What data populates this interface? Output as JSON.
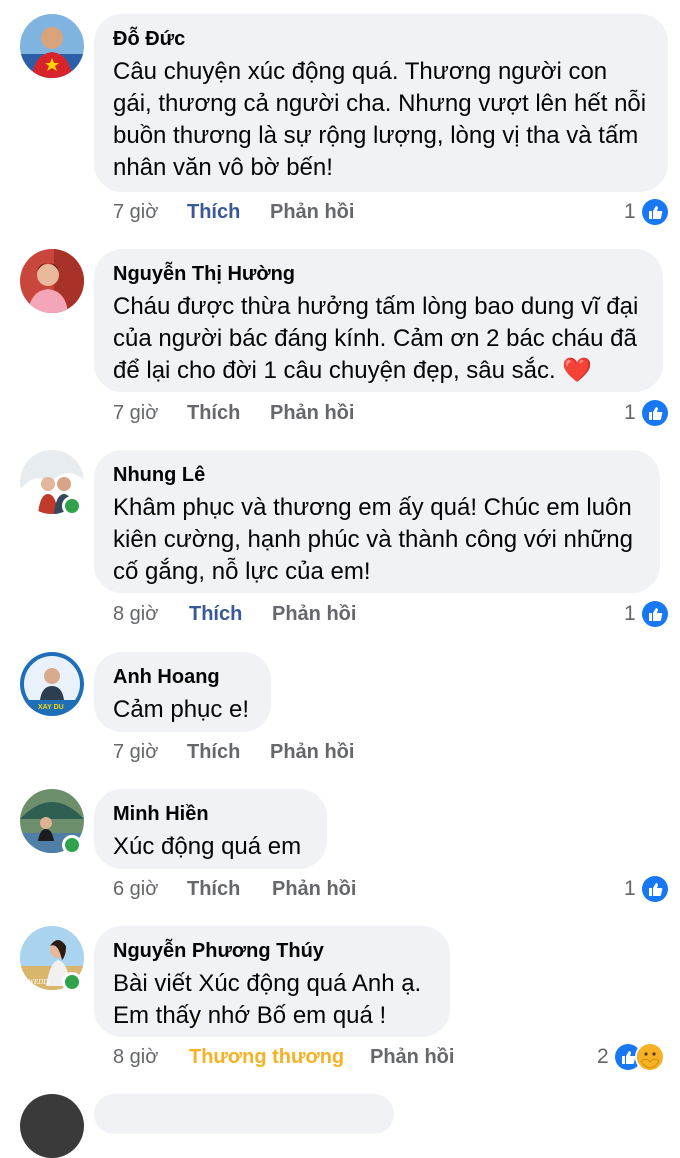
{
  "comments": [
    {
      "author": "Đỗ Đức",
      "text": "Câu chuyện xúc động quá. Thương người con gái, thương cả người cha. Nhưng vượt lên hết nỗi buồn thương là sự rộng lượng, lòng vị tha và tấm nhân văn vô bờ bến!",
      "time": "7 giờ",
      "like_label": "Thích",
      "reply_label": "Phản hồi",
      "reaction_count": "1"
    },
    {
      "author": "Nguyễn Thị Hường",
      "text": "Cháu được thừa hưởng tấm lòng bao dung vĩ đại của người bác đáng kính. Cảm ơn 2 bác cháu đã để lại cho đời 1 câu chuyện đẹp, sâu sắc.",
      "emoji": "❤️",
      "time": "7 giờ",
      "like_label": "Thích",
      "reply_label": "Phản hồi",
      "reaction_count": "1"
    },
    {
      "author": "Nhung Lê",
      "text": "Khâm phục và thương em ấy quá! Chúc em luôn kiên cường, hạnh phúc và thành công với những cố gắng, nỗ lực của em!",
      "time": "8 giờ",
      "like_label": "Thích",
      "reply_label": "Phản hồi",
      "reaction_count": "1"
    },
    {
      "author": "Anh Hoang",
      "text": "Cảm phục e!",
      "avatar_text": "XAY DU",
      "time": "7 giờ",
      "like_label": "Thích",
      "reply_label": "Phản hồi"
    },
    {
      "author": "Minh Hiền",
      "text": "Xúc động quá em",
      "time": "6 giờ",
      "like_label": "Thích",
      "reply_label": "Phản hồi",
      "reaction_count": "1"
    },
    {
      "author": "Nguyễn Phương Thúy",
      "text_line1": "Bài viết Xúc động quá Anh ạ.",
      "text_line2": "Em thấy nhớ Bố em quá !",
      "avatar_text": "WEDDI",
      "time": "8 giờ",
      "like_label": "Thương thương",
      "reply_label": "Phản hồi",
      "reaction_count": "2"
    }
  ],
  "colors": {
    "bubble": "#f0f2f5",
    "meta_text": "#65676b",
    "like_active": "#385898",
    "care_reaction": "#f7b125",
    "like_icon": "#1877f2",
    "online_dot": "#31a24c",
    "heart": "#e0245e"
  },
  "icons": [
    "like-reaction-icon",
    "care-reaction-icon",
    "online-status-icon",
    "heart-emoji-icon"
  ]
}
